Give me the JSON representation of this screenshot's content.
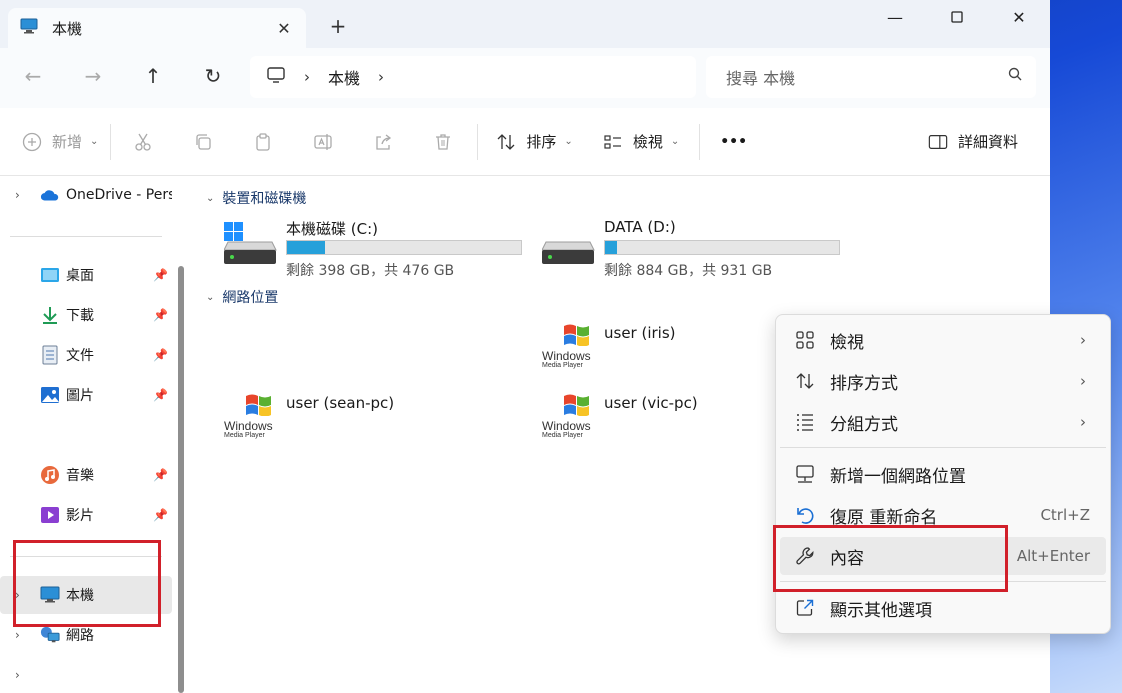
{
  "tab": {
    "title": "本機"
  },
  "nav": {
    "breadcrumb": [
      "本機"
    ],
    "search_placeholder": "搜尋 本機"
  },
  "toolbar": {
    "new_label": "新增",
    "sort_label": "排序",
    "view_label": "檢視",
    "more_label": "•••",
    "details_label": "詳細資料"
  },
  "sidebar": {
    "onedrive": "OneDrive - Pers",
    "quick": [
      {
        "label": "桌面"
      },
      {
        "label": "下載"
      },
      {
        "label": "文件"
      },
      {
        "label": "圖片"
      },
      {
        "label": "音樂"
      },
      {
        "label": "影片"
      }
    ],
    "this_pc": "本機",
    "network": "網路"
  },
  "content": {
    "devices_header": "裝置和磁碟機",
    "drives": [
      {
        "name": "本機磁碟 (C:)",
        "free": "剩餘 398 GB，共 476 GB",
        "used_fraction": 0.164
      },
      {
        "name": "DATA (D:)",
        "free": "剩餘 884 GB，共 931 GB",
        "used_fraction": 0.05
      }
    ],
    "network_header": "網路位置",
    "network_items": [
      {
        "label": "user (iris)"
      },
      {
        "label": "user (sean-pc)"
      },
      {
        "label": "user (vic-pc)"
      }
    ],
    "wmp_logo_text": "Windows",
    "wmp_logo_sub": "Media Player"
  },
  "menu": {
    "items": [
      {
        "label": "檢視"
      },
      {
        "label": "排序方式"
      },
      {
        "label": "分組方式"
      },
      {
        "label": "新增一個網路位置"
      },
      {
        "label": "復原 重新命名",
        "shortcut": "Ctrl+Z"
      },
      {
        "label": "內容",
        "shortcut": "Alt+Enter"
      },
      {
        "label": "顯示其他選項"
      }
    ]
  },
  "colors": {
    "accent": "#26a0da",
    "highlight_box": "#d1202a"
  }
}
